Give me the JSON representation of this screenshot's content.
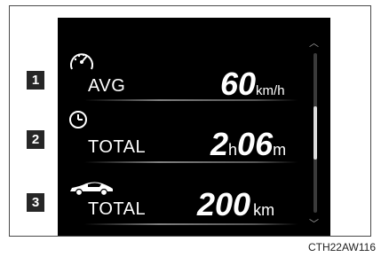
{
  "rows": [
    {
      "badge": "1",
      "icon": "speedometer-icon",
      "label": "AVG",
      "value": "60",
      "unit": "km/h"
    },
    {
      "badge": "2",
      "icon": "clock-icon",
      "label": "TOTAL",
      "value_h": "2",
      "unit_h": "h",
      "value_m": "06",
      "unit_m": "m"
    },
    {
      "badge": "3",
      "icon": "car-icon",
      "label": "TOTAL",
      "value": "200",
      "unit": "km"
    }
  ],
  "scroll": {
    "up_icon": "chevron-up-icon",
    "down_icon": "chevron-down-icon",
    "up_glyph": "︿",
    "down_glyph": "﹀"
  },
  "figure_code": "CTH22AW116",
  "colors": {
    "screen": "#000000",
    "badge": "#262626",
    "text": "#ffffff",
    "scroll_thumb": "#dcdcdc"
  }
}
